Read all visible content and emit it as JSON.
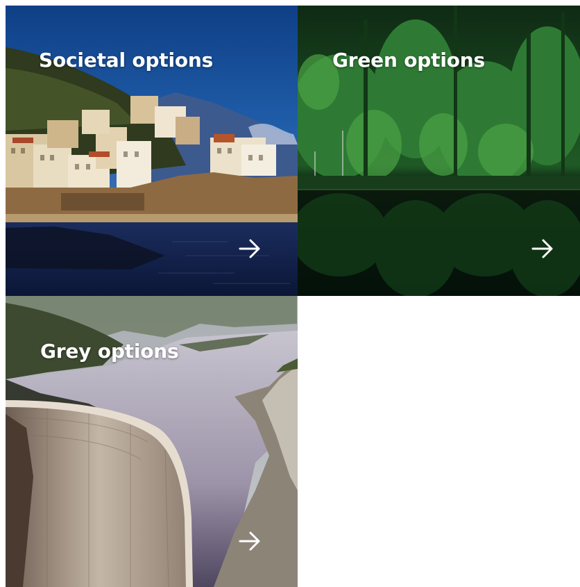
{
  "tiles": [
    {
      "title": "Societal options",
      "arrow_icon": "arrow-right-icon",
      "scene": "coastal-town-image"
    },
    {
      "title": "Green options",
      "arrow_icon": "arrow-right-icon",
      "scene": "forest-lake-image"
    },
    {
      "title": "Grey options",
      "arrow_icon": "arrow-right-icon",
      "scene": "dam-image"
    }
  ],
  "colors": {
    "title_text": "#ffffff",
    "arrow": "#ffffff",
    "background": "#ffffff"
  }
}
